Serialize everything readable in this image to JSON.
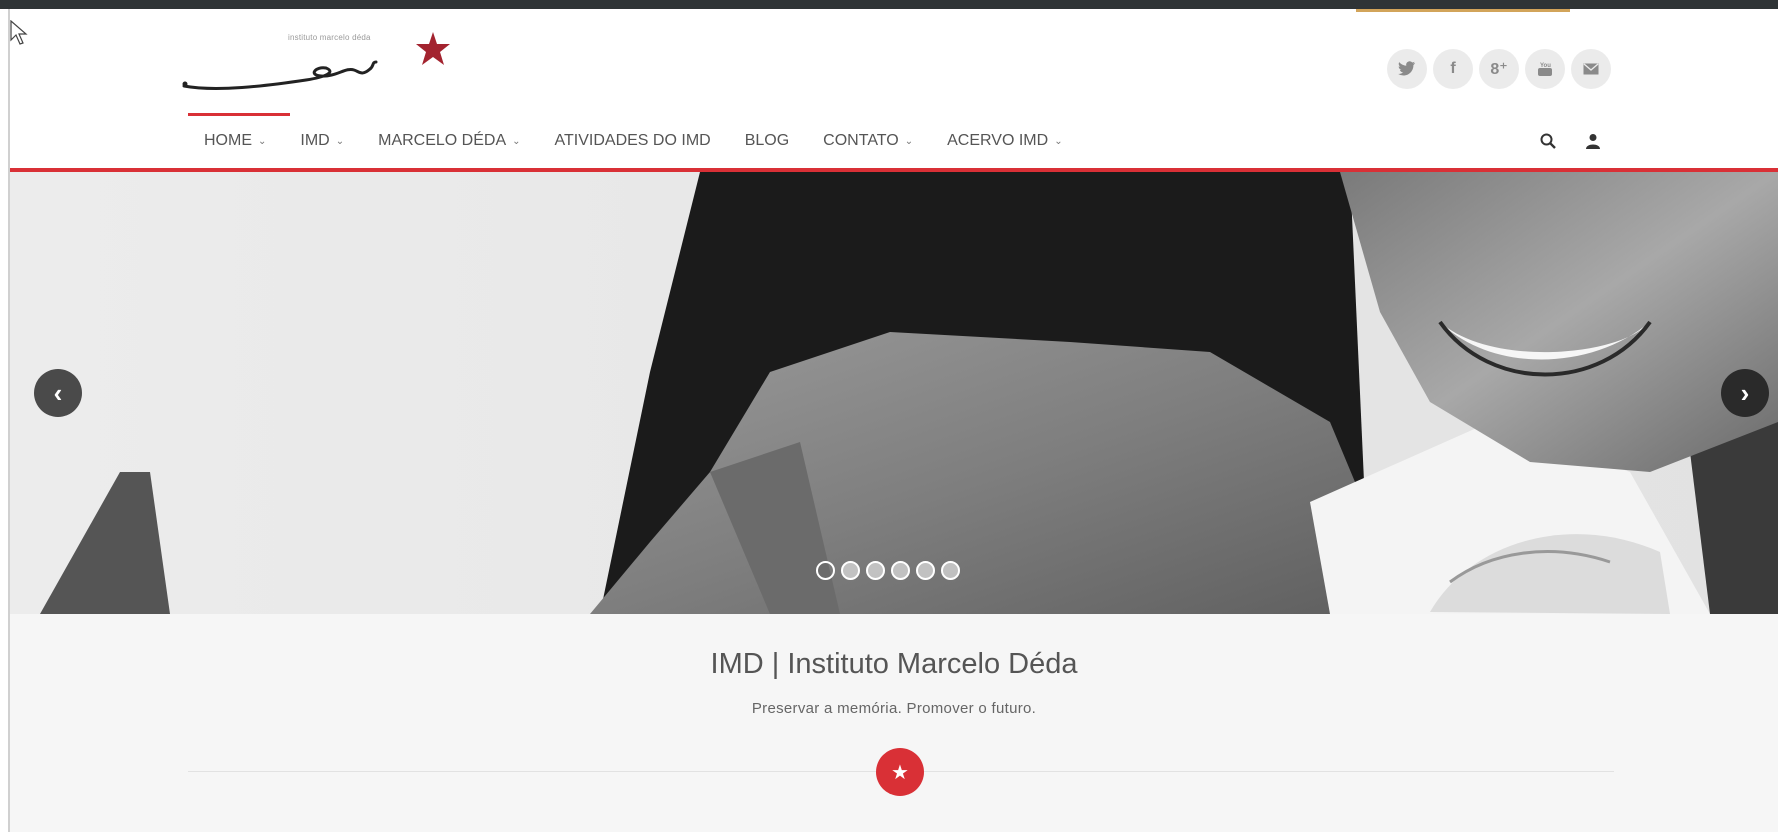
{
  "header": {
    "logo_text": "instituto marcelo déda",
    "social": [
      {
        "icon": "twitter-icon",
        "glyph": "🐦",
        "label": "twitter"
      },
      {
        "icon": "facebook-icon",
        "glyph": "f",
        "label": "facebook"
      },
      {
        "icon": "google-plus-icon",
        "glyph": "8⁺",
        "label": "google-plus"
      },
      {
        "icon": "youtube-icon",
        "glyph": "▣",
        "label": "youtube"
      },
      {
        "icon": "mail-icon",
        "glyph": "✉",
        "label": "mail"
      }
    ]
  },
  "nav": {
    "items": [
      {
        "label": "HOME",
        "has_dropdown": true,
        "active": true
      },
      {
        "label": "IMD",
        "has_dropdown": true
      },
      {
        "label": "MARCELO DÉDA",
        "has_dropdown": true
      },
      {
        "label": "ATIVIDADES DO IMD",
        "has_dropdown": false
      },
      {
        "label": "BLOG",
        "has_dropdown": false
      },
      {
        "label": "CONTATO",
        "has_dropdown": true
      },
      {
        "label": "ACERVO IMD",
        "has_dropdown": true
      }
    ],
    "chevron": "⌄",
    "search_glyph": "🔍",
    "user_glyph": "👤"
  },
  "slider": {
    "prev_glyph": "‹",
    "next_glyph": "›",
    "slide_count": 6,
    "active_slide": 1
  },
  "intro": {
    "title": "IMD | Instituto Marcelo Déda",
    "subtitle": "Preservar a memória. Promover o futuro.",
    "badge_glyph": "★"
  },
  "colors": {
    "accent": "#d93036",
    "gold": "#d2a45a",
    "dark": "#2f3436"
  }
}
